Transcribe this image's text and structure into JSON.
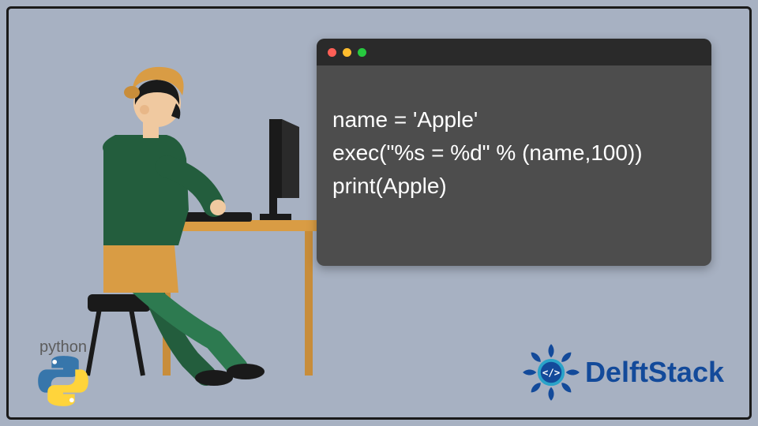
{
  "code": {
    "line1": "name = 'Apple'",
    "line2": "exec(\"%s = %d\" % (name,100))",
    "line3": "print(Apple)"
  },
  "python_label": "python",
  "brand": "DelftStack",
  "window_dots": [
    "red",
    "yellow",
    "green"
  ]
}
